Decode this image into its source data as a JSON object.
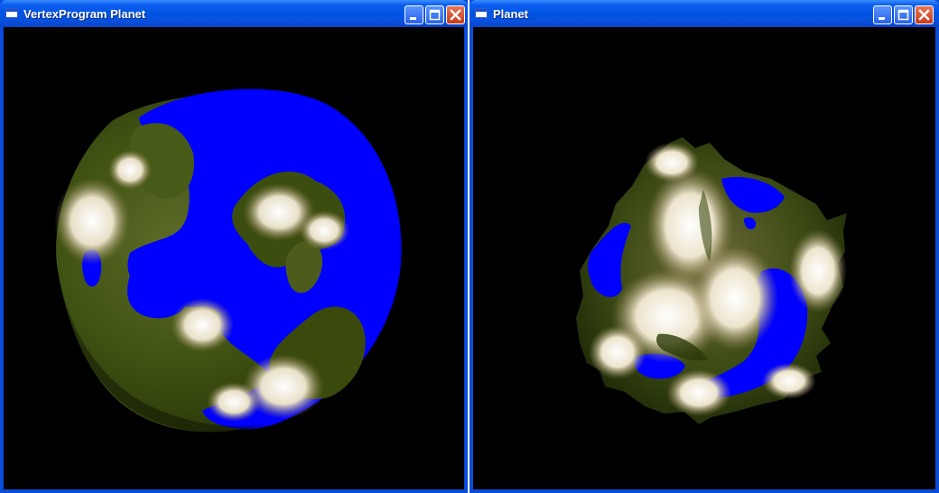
{
  "windows": [
    {
      "title": "VertexProgram Planet",
      "buttons": {
        "minimize": "minimize",
        "maximize": "maximize",
        "close": "close"
      }
    },
    {
      "title": "Planet",
      "buttons": {
        "minimize": "minimize",
        "maximize": "maximize",
        "close": "close"
      }
    }
  ],
  "colors": {
    "ocean": "#0000ff",
    "land_dark": "#2a3a08",
    "land_mid": "#4e6020",
    "land_light": "#7a6a3a",
    "snow": "#f4f0e4",
    "background": "#000000",
    "titlebar": "#0054e3",
    "close_button": "#d64a26"
  },
  "icons": {
    "app": "window-app-icon",
    "minimize": "minimize-icon",
    "maximize": "maximize-icon",
    "close": "close-icon"
  }
}
